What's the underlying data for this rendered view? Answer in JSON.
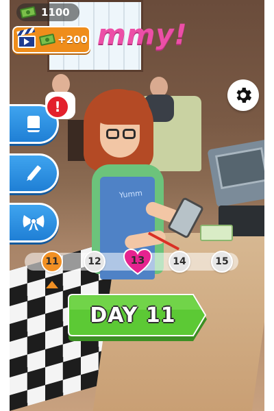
{
  "hud": {
    "cash_amount": "1100",
    "ad_reward": "+200",
    "sign_text": "mmy!",
    "apron_text": "Yumm"
  },
  "progress": {
    "days": [
      "11",
      "12",
      "13",
      "14",
      "15"
    ],
    "current_day": "11",
    "highlighted_day": "13"
  },
  "main_button": {
    "label": "DAY 11"
  },
  "badges": {
    "alert": "!"
  },
  "colors": {
    "accent_green": "#5cc935",
    "accent_blue": "#2a8fe3",
    "accent_orange": "#ef8d1b",
    "heart_pink": "#e6238f",
    "alert_red": "#e3202c"
  },
  "icons": {
    "cash": "cash-bill-icon",
    "ad": "video-clapper-icon",
    "settings": "gear-icon",
    "side_1": "book-icon",
    "side_2": "pencil-icon",
    "side_3": "bow-icon"
  }
}
